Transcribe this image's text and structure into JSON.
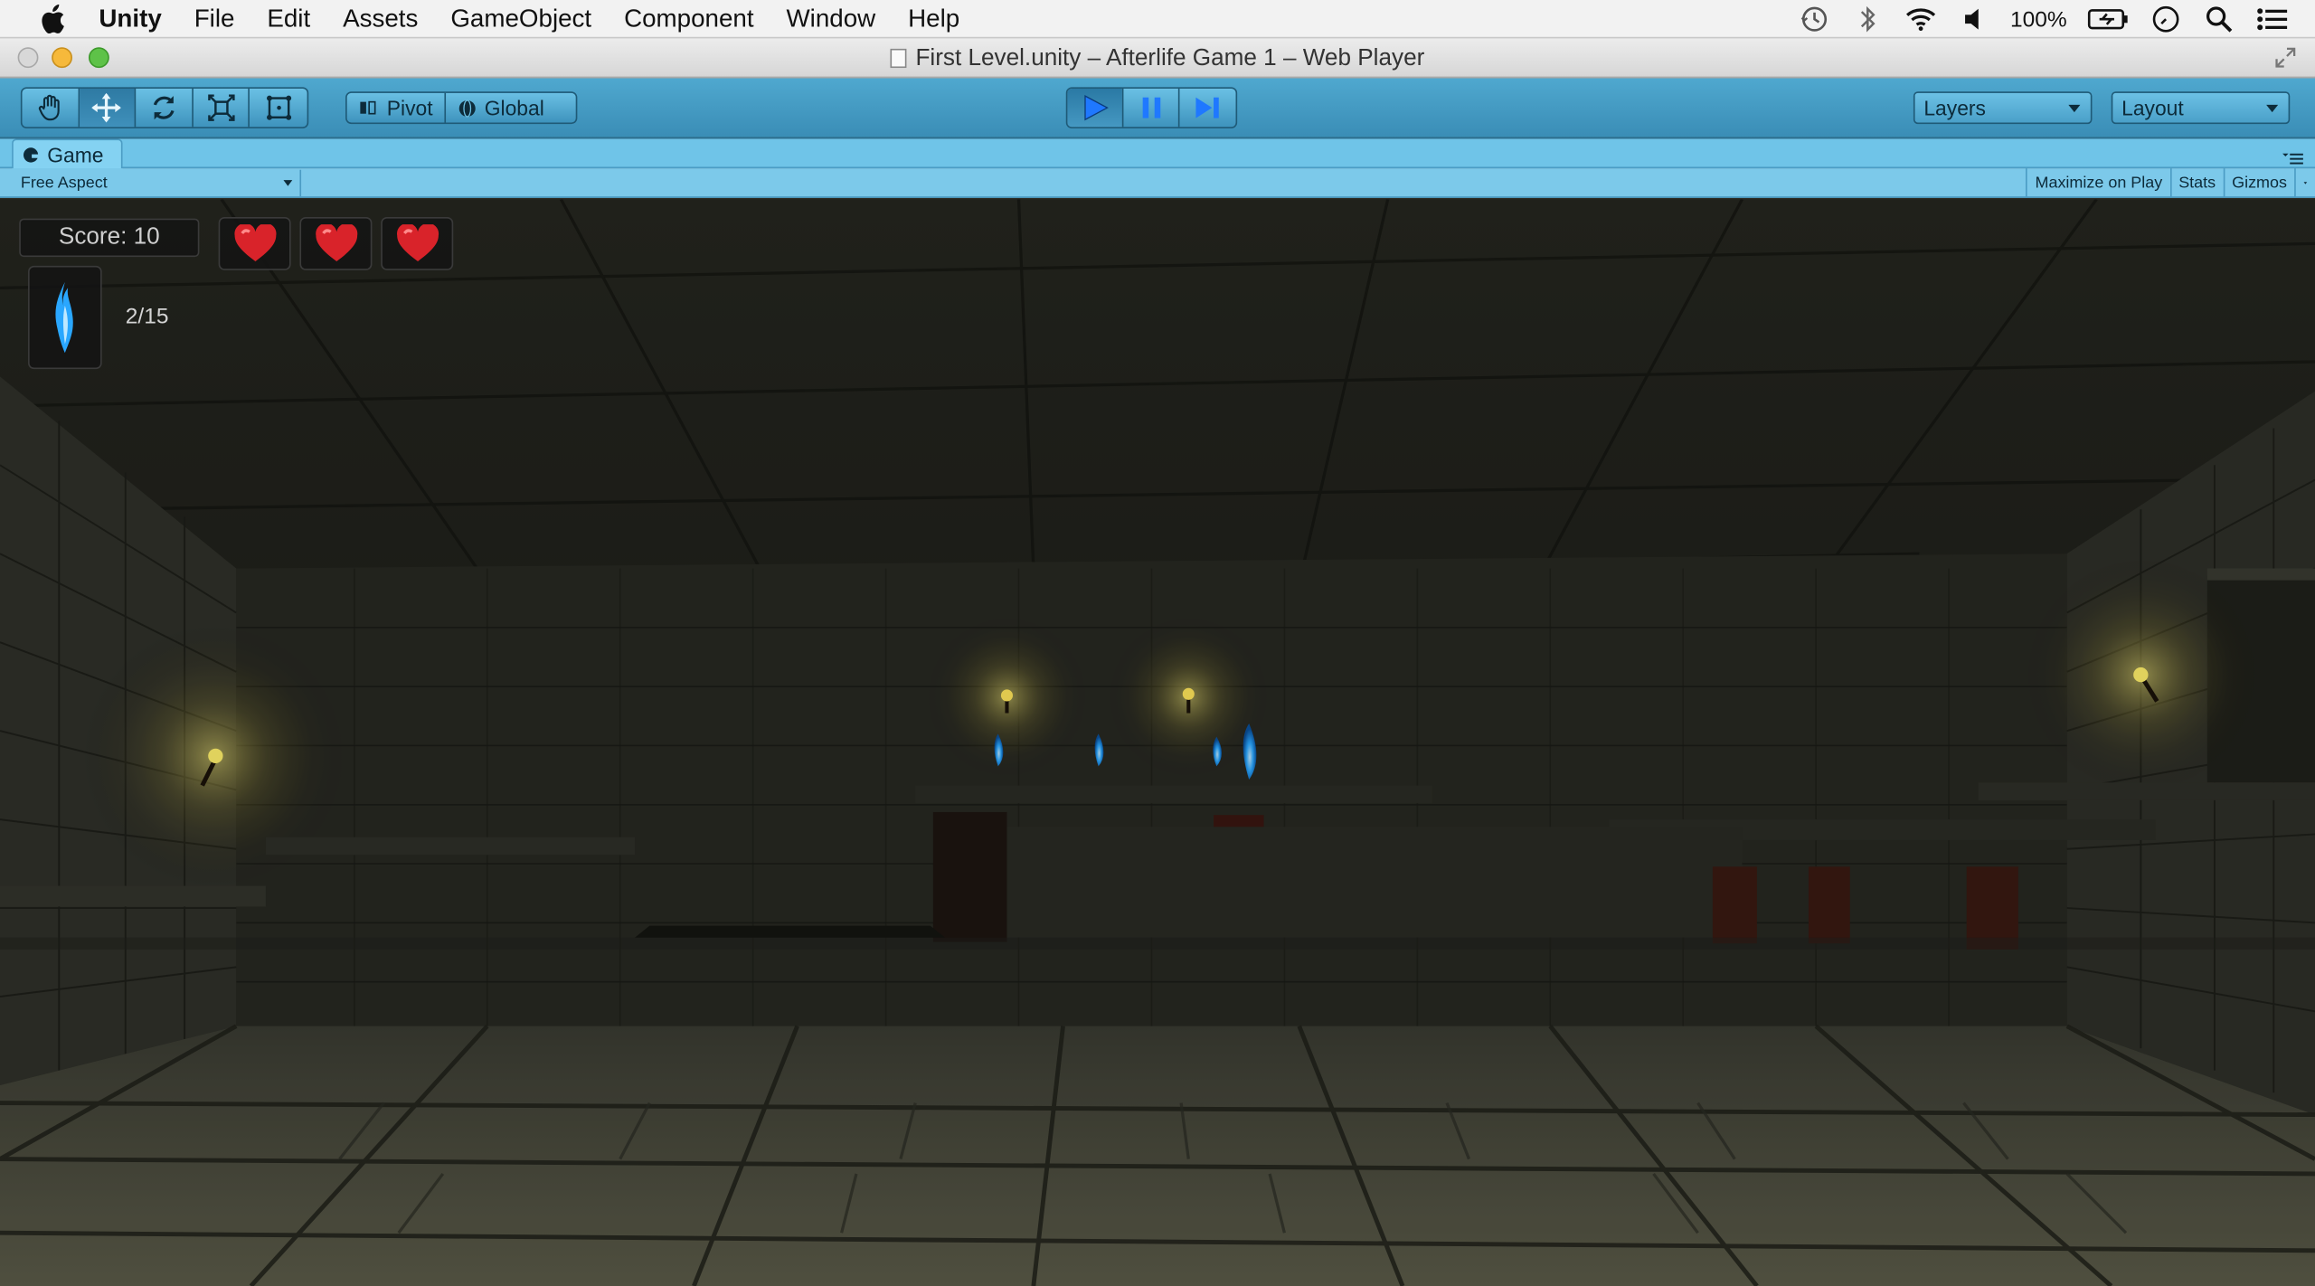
{
  "menubar": {
    "apple_icon": "apple-icon",
    "app_name": "Unity",
    "items": [
      "File",
      "Edit",
      "Assets",
      "GameObject",
      "Component",
      "Window",
      "Help"
    ],
    "battery_percent": "100%",
    "status_icons": [
      "time-machine-icon",
      "bluetooth-icon",
      "wifi-icon",
      "volume-icon",
      "battery-icon",
      "clock-icon",
      "spotlight-icon",
      "notification-list-icon"
    ]
  },
  "window": {
    "title": "First Level.unity – Afterlife Game 1 – Web Player"
  },
  "toolbar": {
    "transform_tools": [
      "hand-tool-icon",
      "move-tool-icon",
      "rotate-tool-icon",
      "scale-tool-icon",
      "rect-tool-icon"
    ],
    "pivot_label": "Pivot",
    "global_label": "Global",
    "playback": [
      "play-icon",
      "pause-icon",
      "step-icon"
    ],
    "layers_label": "Layers",
    "layout_label": "Layout"
  },
  "game_tab": {
    "label": "Game",
    "aspect": "Free Aspect",
    "maximize_label": "Maximize on Play",
    "stats_label": "Stats",
    "gizmos_label": "Gizmos"
  },
  "hud": {
    "score_text": "Score: 10",
    "hearts": 3,
    "souls_text": "2/15"
  },
  "colors": {
    "toolbar": "#4aa3cc",
    "tab": "#84d2f2",
    "heart": "#d9232a",
    "soul_flame": "#2aa7ff",
    "torch": "#ffe55a"
  }
}
